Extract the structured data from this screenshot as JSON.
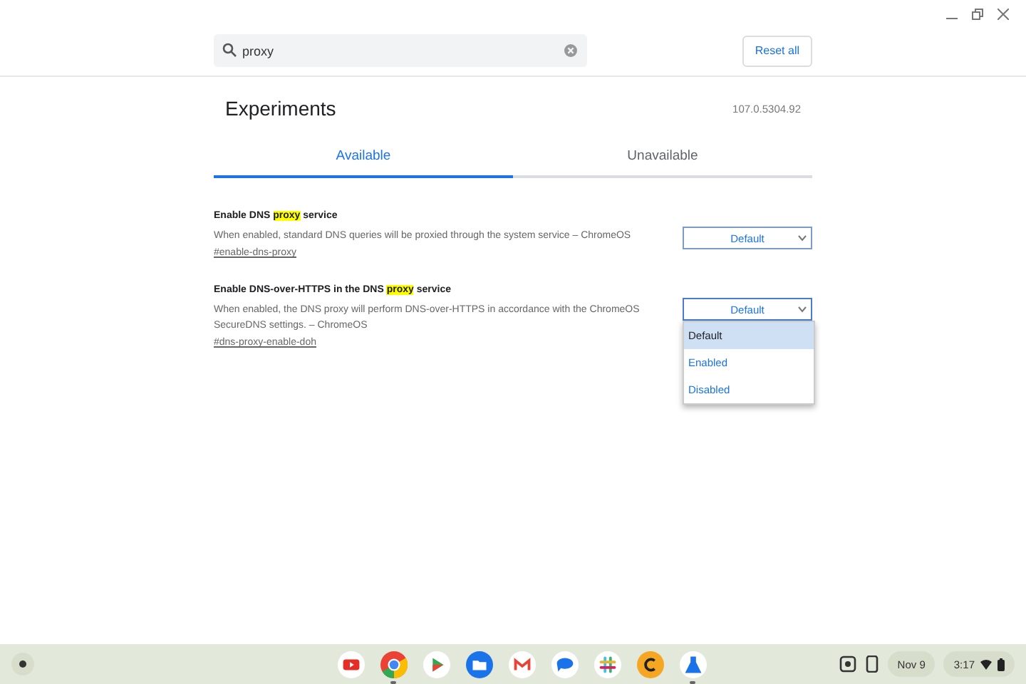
{
  "search": {
    "value": "proxy"
  },
  "reset_button": "Reset all",
  "header": {
    "title": "Experiments",
    "version": "107.0.5304.92"
  },
  "tabs": [
    {
      "label": "Available",
      "selected": true
    },
    {
      "label": "Unavailable",
      "selected": false
    }
  ],
  "experiments": [
    {
      "title_parts": [
        {
          "text": "Enable DNS ",
          "highlight": false
        },
        {
          "text": "proxy",
          "highlight": true
        },
        {
          "text": " service",
          "highlight": false
        }
      ],
      "description": "When enabled, standard DNS queries will be proxied through the system service – ChromeOS",
      "link": "#enable-dns-proxy",
      "select": {
        "value": "Default",
        "expanded": false
      }
    },
    {
      "title_parts": [
        {
          "text": "Enable DNS-over-HTTPS in the DNS ",
          "highlight": false
        },
        {
          "text": "proxy",
          "highlight": true
        },
        {
          "text": " service",
          "highlight": false
        }
      ],
      "description": "When enabled, the DNS proxy will perform DNS-over-HTTPS in accordance with the ChromeOS SecureDNS settings. – ChromeOS",
      "link": "#dns-proxy-enable-doh",
      "select": {
        "value": "Default",
        "expanded": true,
        "options": [
          {
            "label": "Default",
            "selected": true
          },
          {
            "label": "Enabled",
            "selected": false
          },
          {
            "label": "Disabled",
            "selected": false
          }
        ]
      }
    }
  ],
  "shelf": {
    "apps": [
      {
        "kind": "youtube",
        "running": false
      },
      {
        "kind": "chrome",
        "running": true
      },
      {
        "kind": "play",
        "running": false
      },
      {
        "kind": "files",
        "running": false
      },
      {
        "kind": "gmail",
        "running": false
      },
      {
        "kind": "chat",
        "running": false
      },
      {
        "kind": "slack",
        "running": false
      },
      {
        "kind": "coin",
        "running": false
      },
      {
        "kind": "flask",
        "running": true
      }
    ],
    "date": "Nov 9",
    "time": "3:17"
  }
}
